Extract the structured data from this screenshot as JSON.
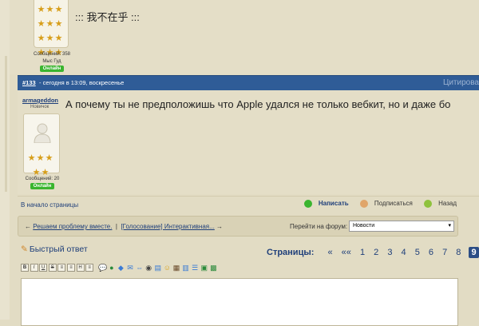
{
  "post1": {
    "message": "::: 我不在乎 :::",
    "messages_label": "Сообщений: 358",
    "location": "Мыс Гуд",
    "status": "Онлайн"
  },
  "post2": {
    "number": "#133",
    "date": " - сегодня в 13:09, воскресенье",
    "quote_label": "Цитирова",
    "username": "armageddon",
    "rank": "Новичок",
    "message": "А почему ты не предположишь что Apple удался не только вебкит, но и даже бо",
    "messages_label": "Сообщений: 20",
    "status": "Онлайн"
  },
  "footer_actions": {
    "to_start": "В начало страницы",
    "write": "Написать",
    "subscribe": "Подписаться",
    "back": "Назад"
  },
  "nav": {
    "prev_arrow": "←",
    "prev_topic": "Решаем проблему вместе.",
    "separator": "|",
    "next_topic": "[Голосование] Интерактивная...",
    "next_arrow": "→",
    "jump_label": "Перейти на форум:",
    "forum_selected": "Новости"
  },
  "quick_reply": {
    "label": "Быстрый ответ"
  },
  "pagination": {
    "label": "Страницы:",
    "first": "«",
    "prev": "««",
    "pages": [
      "1",
      "2",
      "3",
      "4",
      "5",
      "6",
      "7",
      "8"
    ],
    "current": "9"
  },
  "toolbar": {
    "buttons": [
      "B",
      "I",
      "U",
      "S",
      "≡",
      "≡",
      "H",
      "≡"
    ]
  },
  "colors": {
    "header_bar": "#2f5c97",
    "online": "#3ab52f",
    "link": "#1f3f7a"
  }
}
